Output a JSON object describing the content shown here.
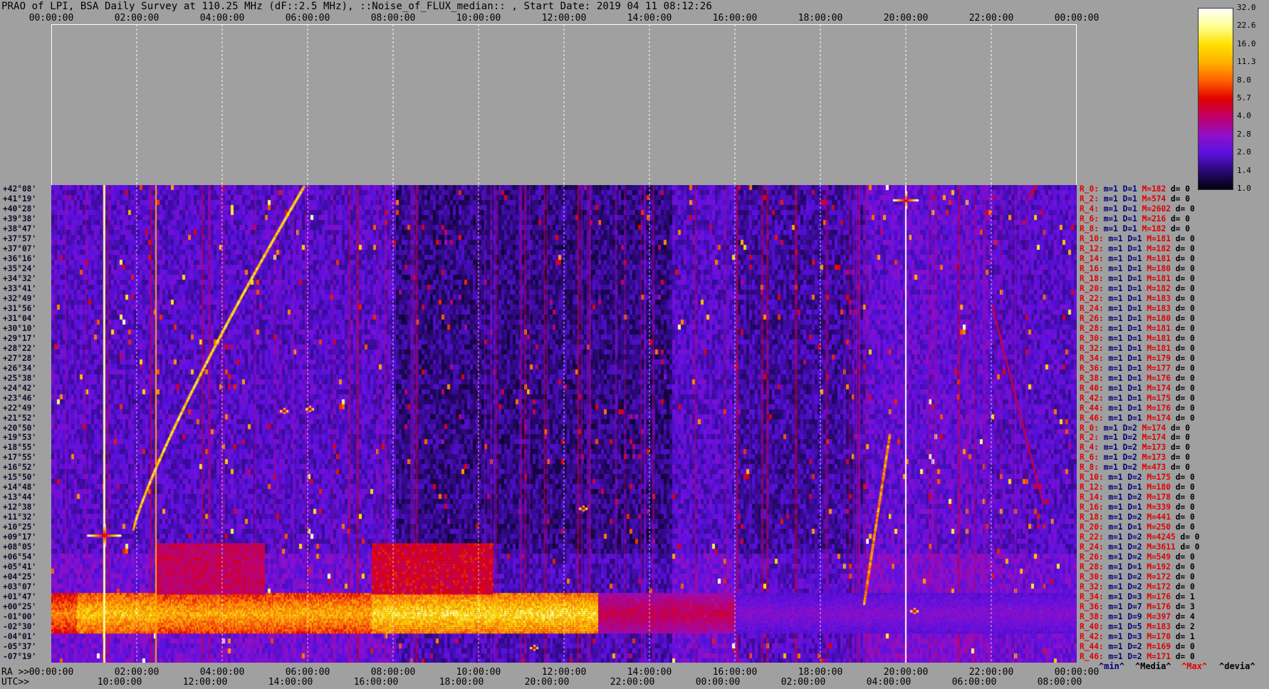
{
  "title": "PRAO of LPI, BSA Daily Survey at 110.25 MHz (dF::2.5 MHz), ::Noise_of_FLUX_median:: , Start Date: 2019 04 11 08:12:26",
  "top_axis_ticks": [
    "00:00:00",
    "02:00:00",
    "04:00:00",
    "06:00:00",
    "08:00:00",
    "10:00:00",
    "12:00:00",
    "14:00:00",
    "16:00:00",
    "18:00:00",
    "20:00:00",
    "22:00:00",
    "00:00:00"
  ],
  "bottom_axis": {
    "ra_label": "RA >>",
    "utc_label": "UTC>>",
    "ra_ticks": [
      "00:00:00",
      "02:00:00",
      "04:00:00",
      "06:00:00",
      "08:00:00",
      "10:00:00",
      "12:00:00",
      "14:00:00",
      "16:00:00",
      "18:00:00",
      "20:00:00",
      "22:00:00",
      "00:00:00"
    ],
    "utc_ticks": [
      "10:00:00",
      "12:00:00",
      "14:00:00",
      "16:00:00",
      "18:00:00",
      "20:00:00",
      "22:00:00",
      "00:00:00",
      "02:00:00",
      "04:00:00",
      "06:00:00",
      "08:00:00"
    ]
  },
  "declinations": [
    "+42°08'",
    "+41°19'",
    "+40°28'",
    "+39°38'",
    "+38°47'",
    "+37°57'",
    "+37°07'",
    "+36°16'",
    "+35°24'",
    "+34°32'",
    "+33°41'",
    "+32°49'",
    "+31°56'",
    "+31°04'",
    "+30°10'",
    "+29°17'",
    "+28°22'",
    "+27°28'",
    "+26°34'",
    "+25°38'",
    "+24°42'",
    "+23°46'",
    "+22°49'",
    "+21°52'",
    "+20°50'",
    "+19°53'",
    "+18°55'",
    "+17°55'",
    "+16°52'",
    "+15°50'",
    "+14°48'",
    "+13°44'",
    "+12°38'",
    "+11°32'",
    "+10°25'",
    "+09°17'",
    "+08°05'",
    "+06°54'",
    "+05°41'",
    "+04°25'",
    "+03°07'",
    "+01°47'",
    "+00°25'",
    "-01°00'",
    "-02°30'",
    "-04°01'",
    "-05°37'",
    "-07°19'"
  ],
  "row_stats": [
    {
      "r": "R_0:",
      "m": "m=1",
      "D": "D=1",
      "M": "M=182",
      "d": "d= 0"
    },
    {
      "r": "R_2:",
      "m": "m=1",
      "D": "D=1",
      "M": "M=574",
      "d": "d= 0"
    },
    {
      "r": "R_4:",
      "m": "m=1",
      "D": "D=1",
      "M": "M=2602",
      "d": "d= 0"
    },
    {
      "r": "R_6:",
      "m": "m=1",
      "D": "D=1",
      "M": "M=216",
      "d": "d= 0"
    },
    {
      "r": "R_8:",
      "m": "m=1",
      "D": "D=1",
      "M": "M=182",
      "d": "d= 0"
    },
    {
      "r": "R_10:",
      "m": "m=1",
      "D": "D=1",
      "M": "M=181",
      "d": "d= 0"
    },
    {
      "r": "R_12:",
      "m": "m=1",
      "D": "D=1",
      "M": "M=182",
      "d": "d= 0"
    },
    {
      "r": "R_14:",
      "m": "m=1",
      "D": "D=1",
      "M": "M=181",
      "d": "d= 0"
    },
    {
      "r": "R_16:",
      "m": "m=1",
      "D": "D=1",
      "M": "M=180",
      "d": "d= 0"
    },
    {
      "r": "R_18:",
      "m": "m=1",
      "D": "D=1",
      "M": "M=181",
      "d": "d= 0"
    },
    {
      "r": "R_20:",
      "m": "m=1",
      "D": "D=1",
      "M": "M=182",
      "d": "d= 0"
    },
    {
      "r": "R_22:",
      "m": "m=1",
      "D": "D=1",
      "M": "M=183",
      "d": "d= 0"
    },
    {
      "r": "R_24:",
      "m": "m=1",
      "D": "D=1",
      "M": "M=183",
      "d": "d= 0"
    },
    {
      "r": "R_26:",
      "m": "m=1",
      "D": "D=1",
      "M": "M=180",
      "d": "d= 0"
    },
    {
      "r": "R_28:",
      "m": "m=1",
      "D": "D=1",
      "M": "M=181",
      "d": "d= 0"
    },
    {
      "r": "R_30:",
      "m": "m=1",
      "D": "D=1",
      "M": "M=181",
      "d": "d= 0"
    },
    {
      "r": "R_32:",
      "m": "m=1",
      "D": "D=1",
      "M": "M=181",
      "d": "d= 0"
    },
    {
      "r": "R_34:",
      "m": "m=1",
      "D": "D=1",
      "M": "M=179",
      "d": "d= 0"
    },
    {
      "r": "R_36:",
      "m": "m=1",
      "D": "D=1",
      "M": "M=177",
      "d": "d= 0"
    },
    {
      "r": "R_38:",
      "m": "m=1",
      "D": "D=1",
      "M": "M=176",
      "d": "d= 0"
    },
    {
      "r": "R_40:",
      "m": "m=1",
      "D": "D=1",
      "M": "M=174",
      "d": "d= 0"
    },
    {
      "r": "R_42:",
      "m": "m=1",
      "D": "D=1",
      "M": "M=175",
      "d": "d= 0"
    },
    {
      "r": "R_44:",
      "m": "m=1",
      "D": "D=1",
      "M": "M=176",
      "d": "d= 0"
    },
    {
      "r": "R_46:",
      "m": "m=1",
      "D": "D=1",
      "M": "M=174",
      "d": "d= 0"
    },
    {
      "r": "R_0:",
      "m": "m=1",
      "D": "D=2",
      "M": "M=174",
      "d": "d= 0"
    },
    {
      "r": "R_2:",
      "m": "m=1",
      "D": "D=2",
      "M": "M=174",
      "d": "d= 0"
    },
    {
      "r": "R_4:",
      "m": "m=1",
      "D": "D=2",
      "M": "M=173",
      "d": "d= 0"
    },
    {
      "r": "R_6:",
      "m": "m=1",
      "D": "D=2",
      "M": "M=173",
      "d": "d= 0"
    },
    {
      "r": "R_8:",
      "m": "m=1",
      "D": "D=2",
      "M": "M=473",
      "d": "d= 0"
    },
    {
      "r": "R_10:",
      "m": "m=1",
      "D": "D=2",
      "M": "M=175",
      "d": "d= 0"
    },
    {
      "r": "R_12:",
      "m": "m=1",
      "D": "D=1",
      "M": "M=180",
      "d": "d= 0"
    },
    {
      "r": "R_14:",
      "m": "m=1",
      "D": "D=2",
      "M": "M=178",
      "d": "d= 0"
    },
    {
      "r": "R_16:",
      "m": "m=1",
      "D": "D=1",
      "M": "M=339",
      "d": "d= 0"
    },
    {
      "r": "R_18:",
      "m": "m=1",
      "D": "D=2",
      "M": "M=441",
      "d": "d= 0"
    },
    {
      "r": "R_20:",
      "m": "m=1",
      "D": "D=1",
      "M": "M=250",
      "d": "d= 0"
    },
    {
      "r": "R_22:",
      "m": "m=1",
      "D": "D=2",
      "M": "M=4245",
      "d": "d= 0"
    },
    {
      "r": "R_24:",
      "m": "m=1",
      "D": "D=2",
      "M": "M=3611",
      "d": "d= 0"
    },
    {
      "r": "R_26:",
      "m": "m=1",
      "D": "D=2",
      "M": "M=549",
      "d": "d= 0"
    },
    {
      "r": "R_28:",
      "m": "m=1",
      "D": "D=1",
      "M": "M=192",
      "d": "d= 0"
    },
    {
      "r": "R_30:",
      "m": "m=1",
      "D": "D=2",
      "M": "M=172",
      "d": "d= 0"
    },
    {
      "r": "R_32:",
      "m": "m=1",
      "D": "D=2",
      "M": "M=172",
      "d": "d= 0"
    },
    {
      "r": "R_34:",
      "m": "m=1",
      "D": "D=3",
      "M": "M=176",
      "d": "d= 1"
    },
    {
      "r": "R_36:",
      "m": "m=1",
      "D": "D=7",
      "M": "M=176",
      "d": "d= 3"
    },
    {
      "r": "R_38:",
      "m": "m=1",
      "D": "D=9",
      "M": "M=397",
      "d": "d= 4"
    },
    {
      "r": "R_40:",
      "m": "m=1",
      "D": "D=5",
      "M": "M=183",
      "d": "d= 2"
    },
    {
      "r": "R_42:",
      "m": "m=1",
      "D": "D=3",
      "M": "M=170",
      "d": "d= 1"
    },
    {
      "r": "R_44:",
      "m": "m=1",
      "D": "D=2",
      "M": "M=169",
      "d": "d= 0"
    },
    {
      "r": "R_46:",
      "m": "m=1",
      "D": "D=2",
      "M": "M=171",
      "d": "d= 0"
    }
  ],
  "colorbar": {
    "labels": [
      "32.0",
      "22.6",
      "16.0",
      "11.3",
      "8.0",
      "5.7",
      "4.0",
      "2.8",
      "2.0",
      "1.4",
      "1.0"
    ],
    "colors": [
      "#ffffff",
      "#ffff90",
      "#ffe000",
      "#ffb000",
      "#ff6000",
      "#e00000",
      "#c0006a",
      "#9010c8",
      "#5a10e0",
      "#280870",
      "#000010"
    ]
  },
  "legend": {
    "min": "^min^",
    "median": "^Media^",
    "max": "^Max^",
    "devia": "^devia^",
    "min_color": "#00007a",
    "median_color": "#000000",
    "max_color": "#e00000",
    "devia_color": "#000000"
  },
  "chart_data": {
    "type": "heatmap",
    "title": "PRAO of LPI, BSA Daily Survey at 110.25 MHz (dF::2.5 MHz), ::Noise_of_FLUX_median:: , Start Date: 2019 04 11 08:12:26",
    "xlabel": "RA",
    "ylabel": "",
    "x_range": [
      "00:00:00",
      "24:00:00"
    ],
    "y_rows": 48,
    "color_scale": "log",
    "color_range": [
      1.0,
      32.0
    ]
  }
}
